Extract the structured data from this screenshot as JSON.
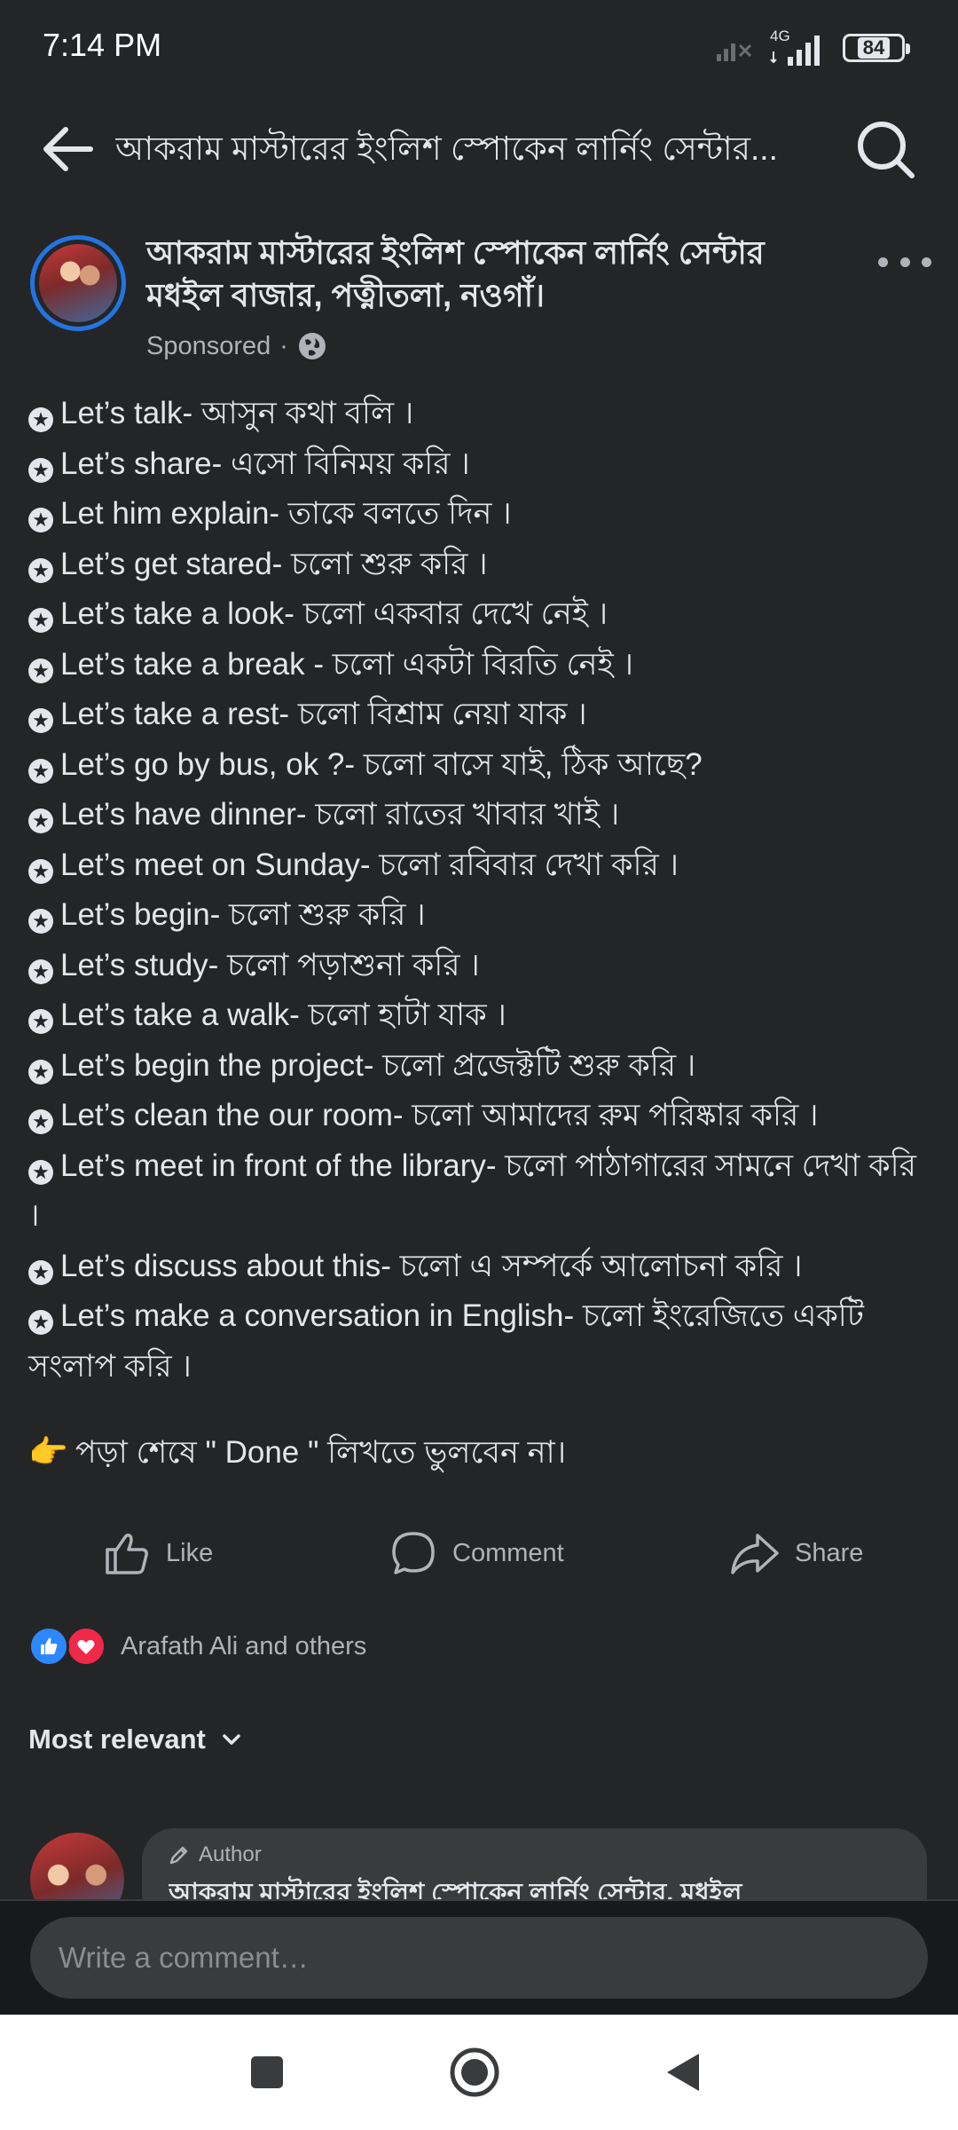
{
  "status_bar": {
    "time": "7:14 PM",
    "network": "4G",
    "battery": "84"
  },
  "header": {
    "title": "আকরাম মাস্টারের ইংলিশ স্পোকেন লার্নিং সেন্টার..."
  },
  "post": {
    "page_name_line1": "আকরাম মাস্টারের ইংলিশ স্পোকেন লার্নিং সেন্টার",
    "page_name_line2": "মধইল বাজার, পত্নীতলা, নওগাঁ।",
    "sponsored": "Sponsored",
    "separator": "·",
    "lines": [
      "Let’s talk- আসুন কথা বলি ।",
      "Let’s share- এসো বিনিময় করি ।",
      "Let him explain- তাকে বলতে দিন ।",
      "Let’s get stared- চলো শুরু করি ।",
      "Let’s take a look- চলো একবার দেখে নেই ।",
      "Let’s take a break - চলো একটা বিরতি নেই ।",
      "Let’s take a rest- চলো বিশ্রাম নেয়া যাক ।",
      "Let’s go by bus, ok ?- চলো বাসে যাই, ঠিক আছে?",
      "Let’s have dinner- চলো রাতের খাবার খাই ।",
      "Let’s meet on Sunday- চলো রবিবার দেখা করি ।",
      "Let’s begin- চলো শুরু করি ।",
      "Let’s study- চলো পড়াশুনা করি ।",
      "Let’s take a walk- চলো হাটা যাক ।",
      "Let’s begin the project- চলো প্রজেক্টটি শুরু করি ।",
      "Let’s clean the our room- চলো আমাদের রুম পরিষ্কার করি ।",
      "Let’s meet in front of the library- চলো পাঠাগারের সামনে দেখা করি ।",
      "Let’s discuss about this- চলো এ সম্পর্কে আলোচনা করি ।",
      "Let’s make a conversation in English- চলো ইংরেজিতে একটি সংলাপ করি ।"
    ],
    "footer_text": "পড়া শেষে \" Done \" লিখতে ভুলবেন না।"
  },
  "actions": {
    "like": "Like",
    "comment": "Comment",
    "share": "Share"
  },
  "reactions": {
    "text": "Arafath Ali and others"
  },
  "comments": {
    "sort_label": "Most relevant",
    "preview": {
      "badge": "Author",
      "name": "আকরাম মাস্টারের ইংলিশ স্পোকেন লার্নিং সেন্টার, মধইল"
    },
    "input_placeholder": "Write a comment…"
  },
  "icons": {
    "back": "back-arrow-icon",
    "search": "search-icon",
    "more": "more-dots-icon",
    "globe": "globe-icon",
    "star": "star-bullet-icon",
    "like": "thumbs-up-icon",
    "comment": "comment-bubble-icon",
    "share": "share-arrow-icon",
    "reaction_like": "like-reaction-icon",
    "reaction_love": "love-reaction-icon",
    "chevron": "chevron-down-icon",
    "pencil": "pencil-icon",
    "hand": "pointing-hand-icon"
  },
  "colors": {
    "background": "#242526",
    "text": "#e4e6eb",
    "secondary": "#b0b3b8",
    "accent": "#2374e1",
    "like": "#2d88ff",
    "love": "#f0284a"
  }
}
